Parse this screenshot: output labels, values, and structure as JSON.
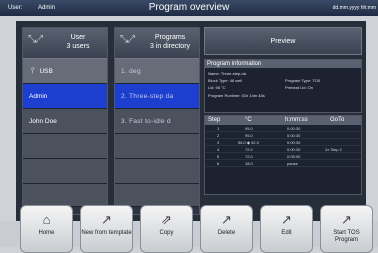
{
  "topbar": {
    "user_label": "User:",
    "user_name": "Admin",
    "title": "Program overview",
    "date": "dd.mm.yyyy hh:mm"
  },
  "users_column": {
    "title": "User",
    "subtitle": "3 users",
    "items": [
      "USB",
      "Admin",
      "John Doe"
    ]
  },
  "programs_column": {
    "title": "Programs",
    "subtitle": "3 in directory",
    "items": [
      "1. deg",
      "2. Three-step da",
      "3. Fast to-idle d"
    ]
  },
  "preview": {
    "label": "Preview"
  },
  "program_info": {
    "heading": "Program information",
    "name": "Name:  Three-step-da",
    "block_type": "Block Type:  48 well",
    "program_type": "Program Type:   TOS",
    "lid": "Lid:              96 °C",
    "preheat_lid": "Preheat Lid:          On",
    "runtime": "Program Runtime:   01h 14m 48s"
  },
  "steps": {
    "headers": [
      "Step",
      "°C",
      "h:mm:ss",
      "GoTo"
    ],
    "rows": [
      [
        "1",
        "95.0",
        "0:00:30",
        ""
      ],
      [
        "2",
        "95.0",
        "0:00:30",
        ""
      ],
      [
        "3",
        "58.0  ◆ 52.0",
        "0:00:30",
        ""
      ],
      [
        "4",
        "72.0",
        "0:00:30",
        "2x  Step   2"
      ],
      [
        "5",
        "72.0",
        "0:05:00",
        ""
      ],
      [
        "6",
        "18.0",
        "pause",
        ""
      ]
    ]
  },
  "buttons": [
    "Home",
    "New from template",
    "Copy",
    "Delete",
    "Edit",
    "Start TOS Program"
  ]
}
